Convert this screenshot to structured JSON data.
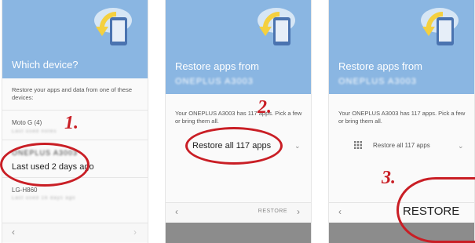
{
  "screen1": {
    "title": "Which device?",
    "description": "Restore your apps and data from one of these devices:",
    "devices": [
      {
        "name": "Moto G (4)",
        "sub": "Last used notes"
      },
      {
        "name": "ONEPLUS A3003",
        "sub": "Last used 2 days ago"
      },
      {
        "name": "LG-H860",
        "sub": "Last used 16 days ago"
      }
    ],
    "back_icon": "‹",
    "next_icon": "›"
  },
  "screen2": {
    "title_line1": "Restore apps from",
    "title_line2": "ONEPLUS A3003",
    "description": "Your ONEPLUS A3003 has 117 apps. Pick a few or bring them all.",
    "restore_all_label": "Restore all 117 apps",
    "back_icon": "‹",
    "next_label": "RESTORE",
    "next_icon": "›"
  },
  "screen3": {
    "title_line1": "Restore apps from",
    "title_line2": "ONEPLUS A3003",
    "description": "Your ONEPLUS A3003 has 117 apps. Pick a few or bring them all.",
    "restore_all_label": "Restore all 117 apps",
    "back_icon": "‹",
    "restore_label": "RESTORE"
  },
  "steps": [
    "1.",
    "2.",
    "3."
  ],
  "colors": {
    "header": "#8ab6e2",
    "highlight": "#c91e25",
    "arrow": "#f4d03f"
  }
}
